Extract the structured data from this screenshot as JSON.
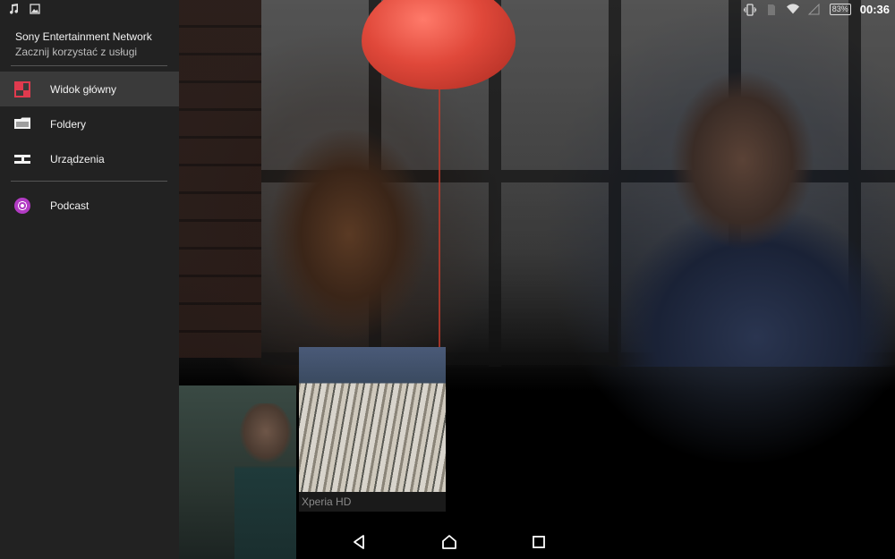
{
  "status_bar": {
    "left_icons": [
      "music-note-icon",
      "image-icon"
    ],
    "right_icons": [
      "vibrate-icon",
      "sim-icon",
      "wifi-icon",
      "signal-icon"
    ],
    "battery": "83%",
    "time": "00:36"
  },
  "drawer": {
    "header": {
      "title": "Sony Entertainment Network",
      "subtitle": "Zacznij korzystać z usługi"
    },
    "items": [
      {
        "label": "Widok główny",
        "icon": "home-grid-icon",
        "active": true
      },
      {
        "label": "Foldery",
        "icon": "folder-icon",
        "active": false
      },
      {
        "label": "Urządzenia",
        "icon": "devices-icon",
        "active": false
      },
      {
        "label": "Podcast",
        "icon": "podcast-icon",
        "active": false
      }
    ]
  },
  "content": {
    "thumbnails": [
      {
        "caption": ""
      },
      {
        "caption": "Xperia HD"
      }
    ]
  },
  "nav_bar": {
    "buttons": [
      "back-icon",
      "home-icon",
      "recents-icon"
    ]
  },
  "colors": {
    "accent_home": "#e03a4e",
    "accent_podcast": "#b23bc4",
    "drawer_bg": "#222222"
  }
}
